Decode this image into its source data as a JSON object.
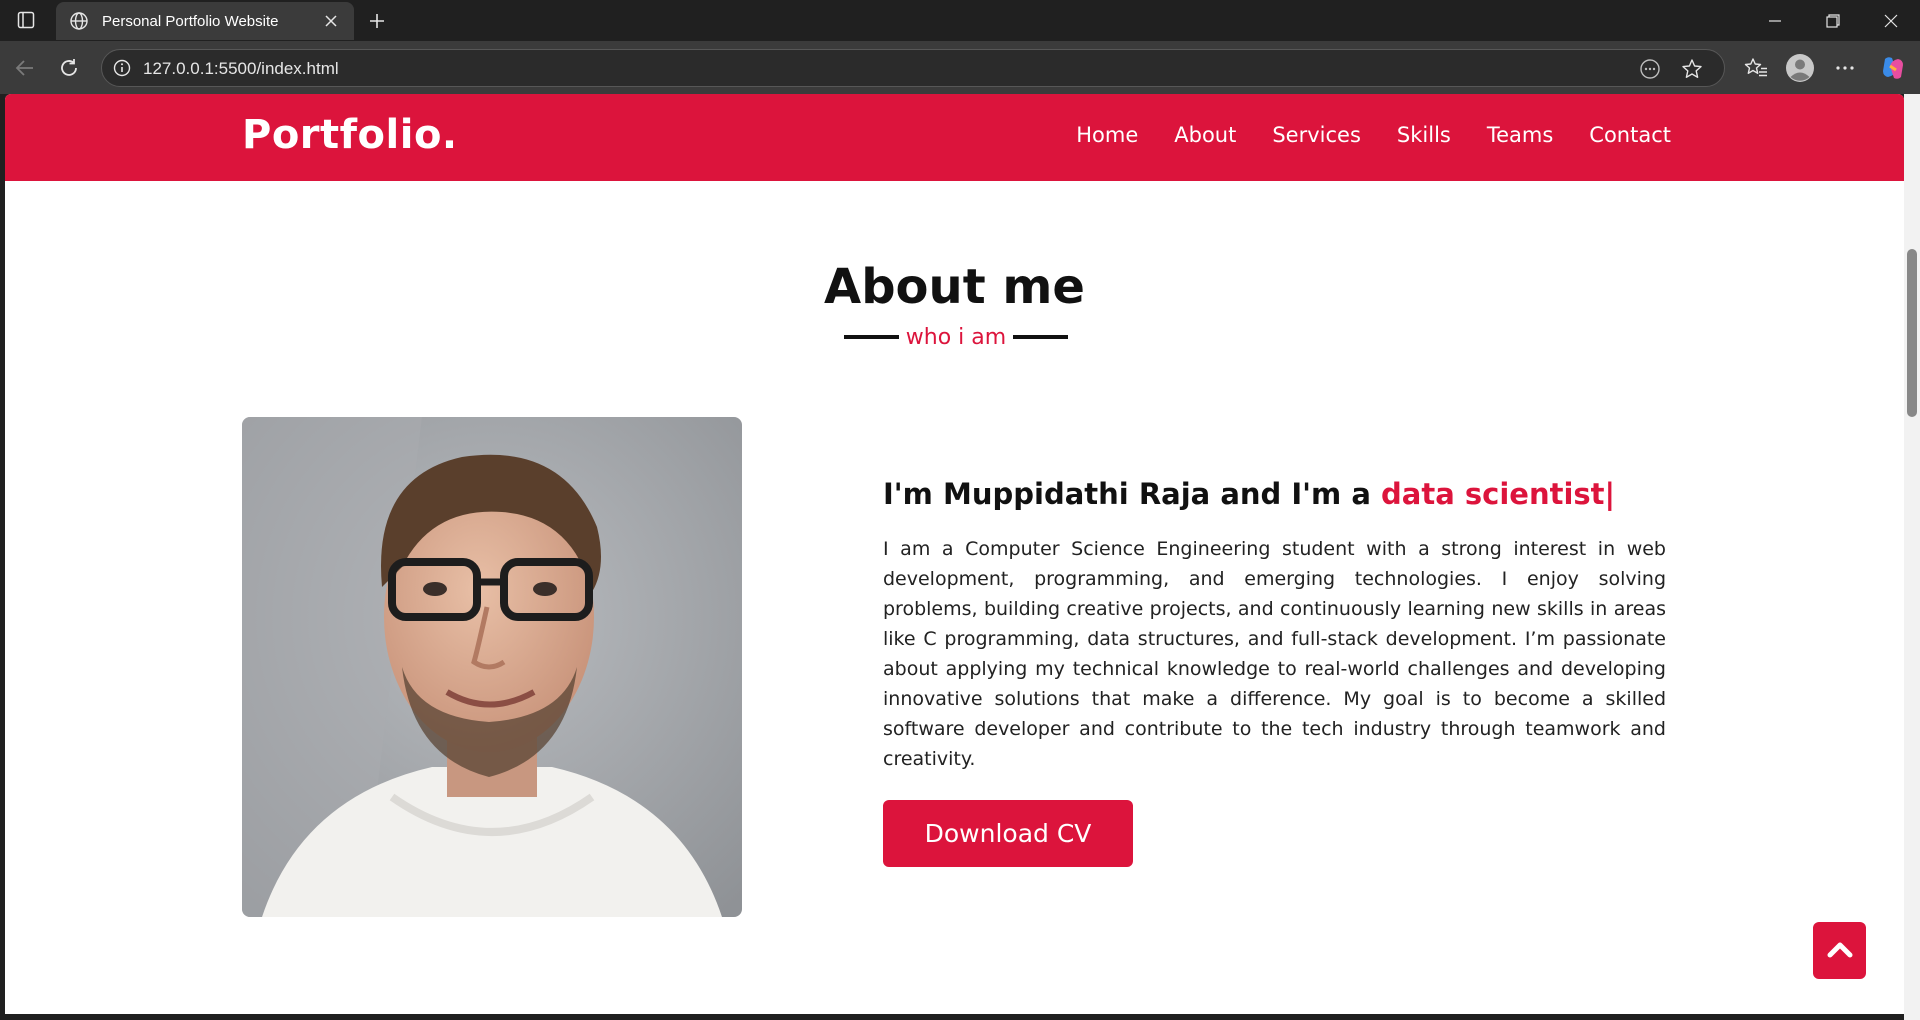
{
  "browser": {
    "tab": {
      "title": "Personal Portfolio Website",
      "favicon": "globe-icon"
    },
    "address_bar": {
      "url": "127.0.0.1:5500/index.html"
    },
    "icons": [
      "tab-actions-icon",
      "globe-icon",
      "close-icon",
      "plus-icon",
      "minimize-icon",
      "restore-icon",
      "close-window-icon",
      "back-arrow-icon",
      "reload-icon",
      "info-icon",
      "reading-mode-icon",
      "star-icon",
      "favorites-icon",
      "profile-icon",
      "more-icon",
      "copilot-icon"
    ]
  },
  "page": {
    "brand_color": "#dc143c",
    "logo": "Portfolio.",
    "nav": [
      "Home",
      "About",
      "Services",
      "Skills",
      "Teams",
      "Contact"
    ],
    "about": {
      "title": "About me",
      "subtitle": "who i am",
      "headline_prefix": "I'm Muppidathi Raja and I'm a ",
      "headline_accent": "data scientist|",
      "bio": "I am a Computer Science Engineering student with a strong interest in web development, programming, and emerging technologies. I enjoy solving problems, building creative projects, and continuously learning new skills in areas like C programming, data structures, and full-stack development. I’m passionate about applying my technical knowledge to real-world challenges and developing innovative solutions that make a difference. My goal is to become a skilled software developer and contribute to the tech industry through teamwork and creativity.",
      "cv_button": "Download CV",
      "photo": "portrait-photo"
    },
    "scroll_top_icon": "chevron-up-icon"
  }
}
